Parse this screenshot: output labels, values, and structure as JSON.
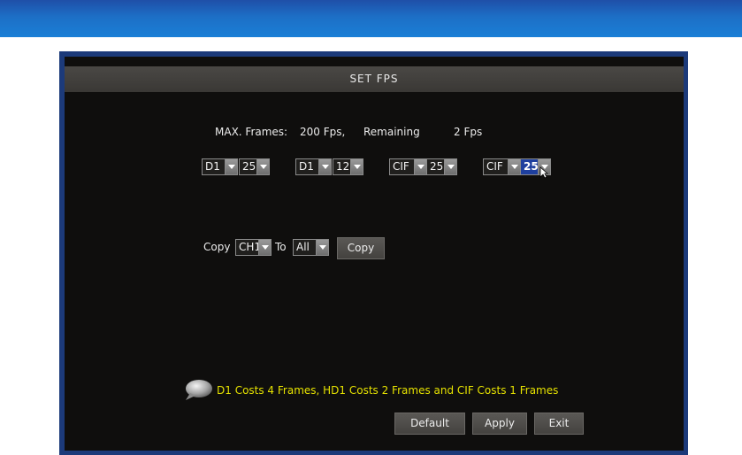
{
  "dialog": {
    "title": "SET FPS",
    "max_label": "MAX. Frames:",
    "max_value": "200 Fps,",
    "remaining_label": "Remaining",
    "remaining_value": "2 Fps"
  },
  "channels": [
    {
      "resolution": "D1",
      "fps": "25"
    },
    {
      "resolution": "D1",
      "fps": "12"
    },
    {
      "resolution": "CIF",
      "fps": "25"
    },
    {
      "resolution": "CIF",
      "fps": "25",
      "selected": true
    }
  ],
  "copy": {
    "label": "Copy",
    "from": "CH1",
    "to_label": "To",
    "to": "All",
    "button": "Copy"
  },
  "hint": "D1  Costs  4  Frames, HD1  Costs  2  Frames  and  CIF  Costs  1 Frames",
  "buttons": {
    "default": "Default",
    "apply": "Apply",
    "exit": "Exit"
  },
  "icons": {
    "hint": "speech-bubble-icon",
    "dropdown": "triangle-down-icon",
    "cursor": "mouse-pointer-icon"
  },
  "colors": {
    "background": "#0f0e0d",
    "hint_text": "#e6e200",
    "selected": "#1e3f9e",
    "header": "#1d6fc6"
  }
}
